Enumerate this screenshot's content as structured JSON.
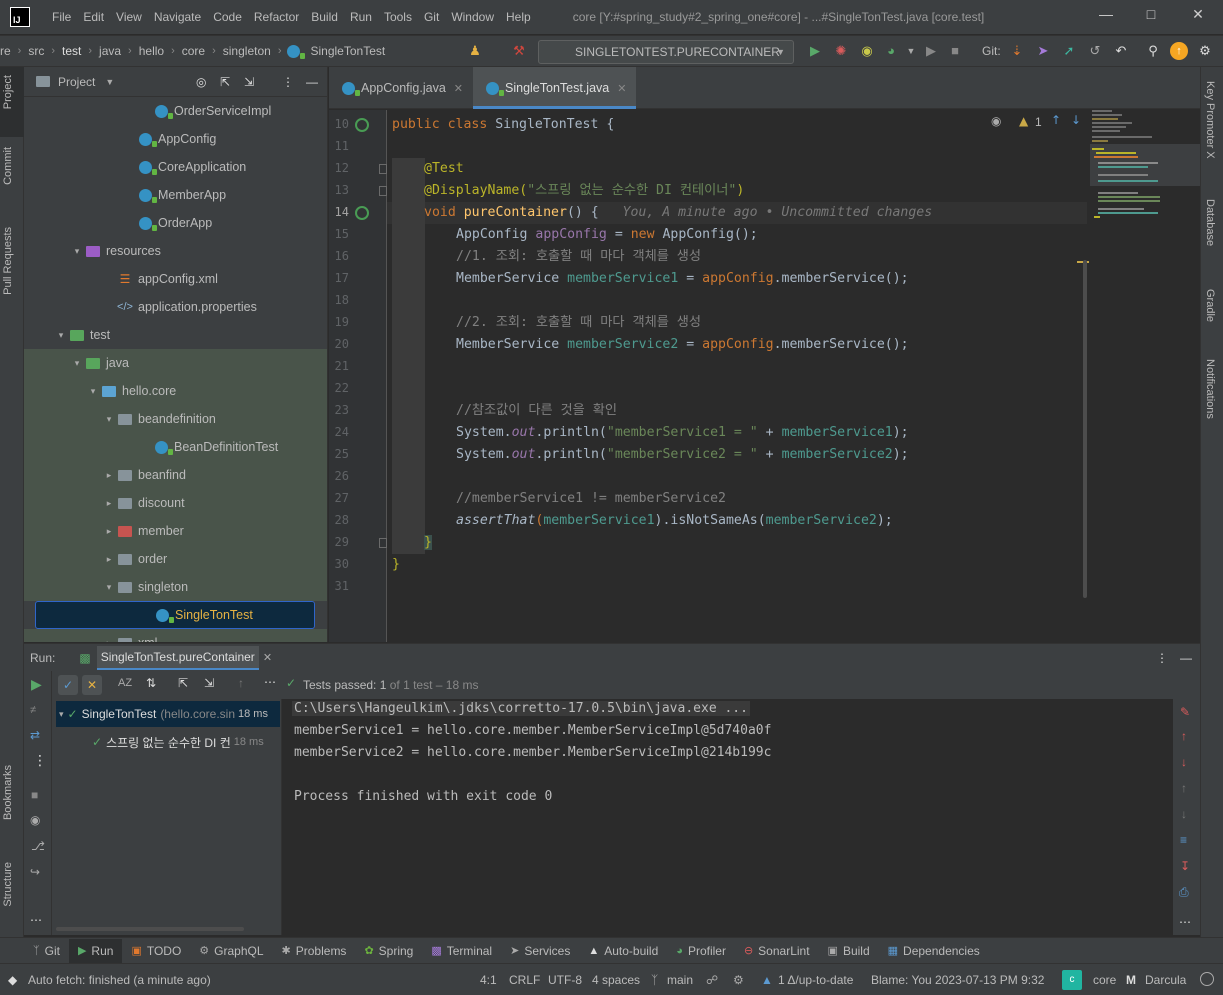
{
  "menu": {
    "logo": "IJ",
    "items": [
      "File",
      "Edit",
      "View",
      "Navigate",
      "Code",
      "Refactor",
      "Build",
      "Run",
      "Tools",
      "Git",
      "Window",
      "Help"
    ],
    "window_title": "core [Y:#spring_study#2_spring_one#core] - ...#SingleTonTest.java [core.test]"
  },
  "breadcrumbs": [
    "re",
    "src",
    "test",
    "java",
    "hello",
    "core",
    "singleton",
    "SingleTonTest"
  ],
  "run_config": "SINGLETONTEST.PURECONTAINER",
  "git_label": "Git:",
  "project_panel": {
    "title": "Project",
    "tree": [
      {
        "label": "OrderServiceImpl",
        "kind": "class",
        "indent": 128,
        "arrow": ""
      },
      {
        "label": "AppConfig",
        "kind": "class",
        "indent": 112,
        "arrow": ""
      },
      {
        "label": "CoreApplication",
        "kind": "class",
        "indent": 112,
        "arrow": ""
      },
      {
        "label": "MemberApp",
        "kind": "class",
        "indent": 112,
        "arrow": ""
      },
      {
        "label": "OrderApp",
        "kind": "class",
        "indent": 112,
        "arrow": ""
      },
      {
        "label": "resources",
        "kind": "folder-purple",
        "indent": 60,
        "arrow": "▾"
      },
      {
        "label": "appConfig.xml",
        "kind": "xml",
        "indent": 92,
        "arrow": ""
      },
      {
        "label": "application.properties",
        "kind": "props",
        "indent": 92,
        "arrow": ""
      },
      {
        "label": "test",
        "kind": "folder-green",
        "indent": 44,
        "arrow": "▾"
      },
      {
        "label": "java",
        "kind": "folder-green",
        "indent": 60,
        "arrow": "▾"
      },
      {
        "label": "hello.core",
        "kind": "package",
        "indent": 76,
        "arrow": "▾"
      },
      {
        "label": "beandefinition",
        "kind": "folder",
        "indent": 92,
        "arrow": "▾"
      },
      {
        "label": "BeanDefinitionTest",
        "kind": "class",
        "indent": 128,
        "arrow": ""
      },
      {
        "label": "beanfind",
        "kind": "folder",
        "indent": 92,
        "arrow": "▸"
      },
      {
        "label": "discount",
        "kind": "folder",
        "indent": 92,
        "arrow": "▸"
      },
      {
        "label": "member",
        "kind": "folder-red",
        "indent": 92,
        "arrow": "▸"
      },
      {
        "label": "order",
        "kind": "folder",
        "indent": 92,
        "arrow": "▸"
      },
      {
        "label": "singleton",
        "kind": "folder",
        "indent": 92,
        "arrow": "▾"
      },
      {
        "label": "SingleTonTest",
        "kind": "class",
        "indent": 128,
        "arrow": "",
        "selected": true
      },
      {
        "label": "xml",
        "kind": "folder",
        "indent": 92,
        "arrow": "▸"
      }
    ]
  },
  "editor_tabs": [
    {
      "label": "AppConfig.java",
      "active": false
    },
    {
      "label": "SingleTonTest.java",
      "active": true
    }
  ],
  "editor": {
    "warnings": "1",
    "line_numbers": [
      "10",
      "11",
      "12",
      "13",
      "14",
      "15",
      "16",
      "17",
      "18",
      "19",
      "20",
      "21",
      "22",
      "23",
      "24",
      "25",
      "26",
      "27",
      "28",
      "29",
      "30",
      "31"
    ],
    "inlay_hint": "You, A minute ago • Uncommitted changes",
    "code": {
      "l10_kw": "public class",
      "l10_rest": " SingleTonTest {",
      "l12": "@Test",
      "l13_ann": "@DisplayName(",
      "l13_str": "\"스프링 없는 순수한 DI 컨테이너\"",
      "l13_end": ")",
      "l14_kw": "void",
      "l14_fn": "pureContainer",
      "l14_rest": "() {",
      "l15_type": "AppConfig ",
      "l15_var": "appConfig",
      "l15_eq": " = ",
      "l15_new": "new",
      "l15_rest": " AppConfig();",
      "l16": "//1. 조회: 호출할 때 마다 객체를 생성",
      "l17_type": "MemberService ",
      "l17_var": "memberService1",
      "l17_eq": " = ",
      "l17_obj": "appConfig",
      "l17_rest": ".memberService();",
      "l19": "//2. 조회: 호출할 때 마다 객체를 생성",
      "l20_type": "MemberService ",
      "l20_var": "memberService2",
      "l20_eq": " = ",
      "l20_obj": "appConfig",
      "l20_rest": ".memberService();",
      "l23": "//참조값이 다른 것을 확인",
      "l24_a": "System.",
      "l24_field": "out",
      "l24_b": ".println(",
      "l24_str": "\"memberService1 = \"",
      "l24_plus": " + ",
      "l24_var": "memberService1",
      "l24_end": ");",
      "l25_a": "System.",
      "l25_field": "out",
      "l25_b": ".println(",
      "l25_str": "\"memberService2 = \"",
      "l25_plus": " + ",
      "l25_var": "memberService2",
      "l25_end": ");",
      "l27": "//memberService1 != memberService2",
      "l28_fn": "assertThat",
      "l28_open": "(",
      "l28_var1": "memberService1",
      "l28_mid": ").isNotSameAs(",
      "l28_var2": "memberService2",
      "l28_end": ");",
      "l29": "}",
      "l30": "}"
    }
  },
  "run_panel": {
    "label": "Run:",
    "tab": "SingleTonTest.pureContainer",
    "status_prefix": "Tests passed:",
    "status_count": "1",
    "status_suffix": "of 1 test – 18 ms",
    "tree": [
      {
        "label": "SingleTonTest",
        "sub": "(hello.core.sin",
        "time": "18 ms"
      },
      {
        "label": "스프링 없는 순수한 DI 컨",
        "sub": "",
        "time": "18 ms"
      }
    ],
    "console": [
      "C:\\Users\\Hangeulkim\\.jdks\\corretto-17.0.5\\bin\\java.exe ...",
      "memberService1 = hello.core.member.MemberServiceImpl@5d740a0f",
      "memberService2 = hello.core.member.MemberServiceImpl@214b199c",
      "",
      "Process finished with exit code 0"
    ]
  },
  "left_stripe": [
    "Project",
    "Commit",
    "Pull Requests",
    "Bookmarks",
    "Structure"
  ],
  "right_stripe": [
    "Key Promoter X",
    "Database",
    "Gradle",
    "Notifications"
  ],
  "bottom_tabs": [
    "Git",
    "Run",
    "TODO",
    "GraphQL",
    "Problems",
    "Spring",
    "Terminal",
    "Services",
    "Auto-build",
    "Profiler",
    "SonarLint",
    "Build",
    "Dependencies"
  ],
  "status_bar": {
    "message": "Auto fetch: finished (a minute ago)",
    "position": "4:1",
    "line_sep": "CRLF",
    "encoding": "UTF-8",
    "indent": "4 spaces",
    "branch": "main",
    "vcs": "1 Δ/up-to-date",
    "blame": "Blame: You 2023-07-13 PM 9:32",
    "project": "core",
    "theme": "Darcula"
  }
}
